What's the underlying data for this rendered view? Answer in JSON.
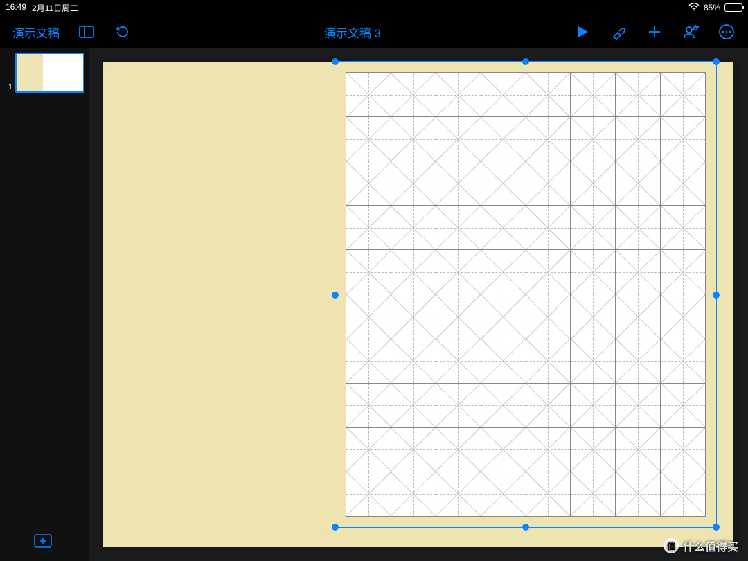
{
  "status": {
    "time": "16:49",
    "date": "2月11日周二",
    "battery_pct": "85%",
    "battery_fill": 85
  },
  "toolbar": {
    "back_label": "演示文稿",
    "title": "演示文稿 3"
  },
  "sidebar": {
    "slides": [
      {
        "num": "1"
      }
    ],
    "add_icon": "add-slide"
  },
  "canvas": {
    "grid_cols": 8,
    "grid_rows": 10
  },
  "watermark": {
    "badge": "值",
    "text": "什么值得买"
  }
}
